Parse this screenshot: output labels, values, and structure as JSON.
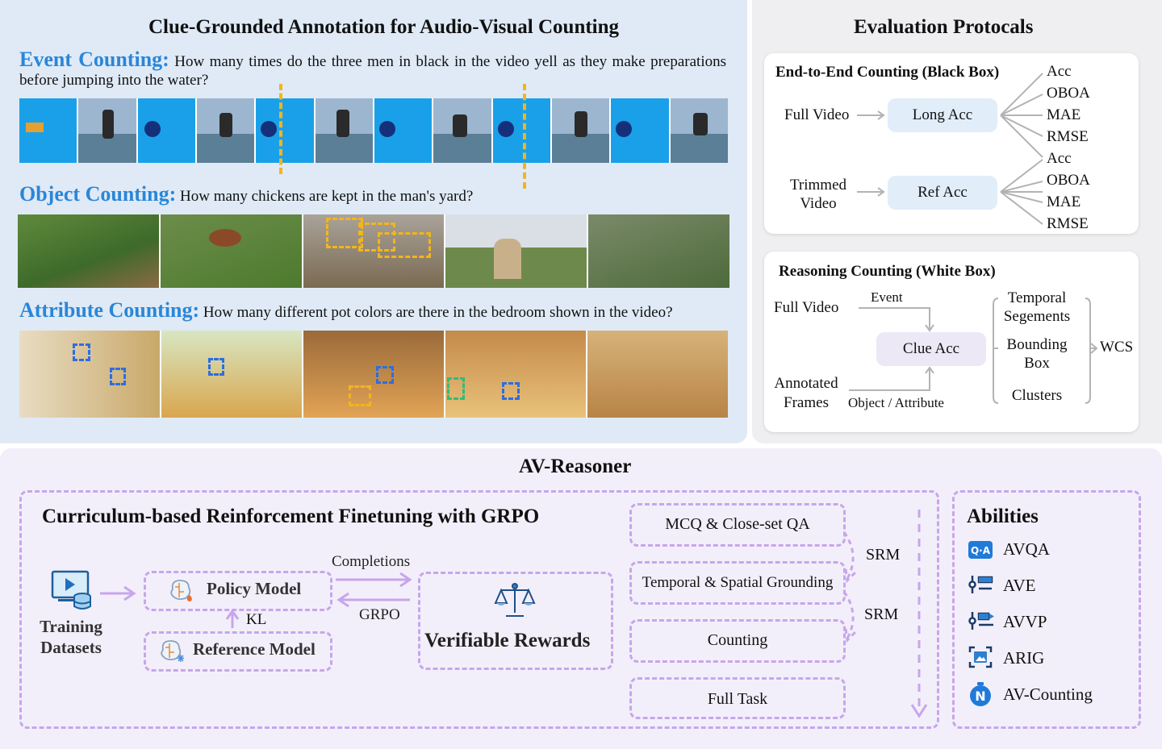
{
  "annotation": {
    "title": "Clue-Grounded Annotation for Audio-Visual Counting",
    "event": {
      "label": "Event Counting:",
      "question": "How many times do the three men in black in the video yell as they make preparations before jumping into the water?"
    },
    "object": {
      "label": "Object Counting:",
      "question": "How many chickens are kept in the man's yard?"
    },
    "attribute": {
      "label": "Attribute Counting:",
      "question": "How many different pot colors are there in the bedroom shown in the video?"
    }
  },
  "evaluation": {
    "title": "Evaluation Protocals",
    "black_box": {
      "title": "End-to-End Counting (Black Box)",
      "full_video": "Full Video",
      "long_acc": "Long Acc",
      "trimmed_video": "Trimmed Video",
      "ref_acc": "Ref Acc",
      "metrics_a": [
        "Acc",
        "OBOA",
        "MAE",
        "RMSE"
      ],
      "metrics_b": [
        "Acc",
        "OBOA",
        "MAE",
        "RMSE"
      ]
    },
    "white_box": {
      "title": "Reasoning Counting (White Box)",
      "full_video": "Full Video",
      "event": "Event",
      "clue_acc": "Clue Acc",
      "annotated_frames": "Annotated Frames",
      "object_attribute": "Object / Attribute",
      "temporal_segments": "Temporal Segements",
      "bounding_box": "Bounding Box",
      "clusters": "Clusters",
      "wcs": "WCS"
    }
  },
  "reasoner": {
    "title": "AV-Reasoner",
    "grpo": {
      "title": "Curriculum-based Reinforcement Finetuning with GRPO",
      "training_datasets": "Training Datasets",
      "policy_model": "Policy Model",
      "reference_model": "Reference Model",
      "kl": "KL",
      "completions": "Completions",
      "grpo_label": "GRPO",
      "verifiable_rewards": "Verifiable Rewards"
    },
    "curriculum": {
      "stages": [
        "MCQ & Close-set QA",
        "Temporal & Spatial Grounding",
        "Counting",
        "Full Task"
      ],
      "srm": "SRM"
    },
    "abilities": {
      "title": "Abilities",
      "items": [
        {
          "label": "AVQA",
          "icon": "qa-icon"
        },
        {
          "label": "AVE",
          "icon": "list-icon"
        },
        {
          "label": "AVVP",
          "icon": "parse-icon"
        },
        {
          "label": "ARIG",
          "icon": "image-ground-icon"
        },
        {
          "label": "AV-Counting",
          "icon": "counter-icon"
        }
      ]
    }
  },
  "colors": {
    "accent_blue": "#2a86d8",
    "pill_blue": "#e1edf9",
    "pill_purple": "#ece8f5",
    "dash_purple": "#c7a6ec",
    "box_yellow": "#f2b51e"
  }
}
